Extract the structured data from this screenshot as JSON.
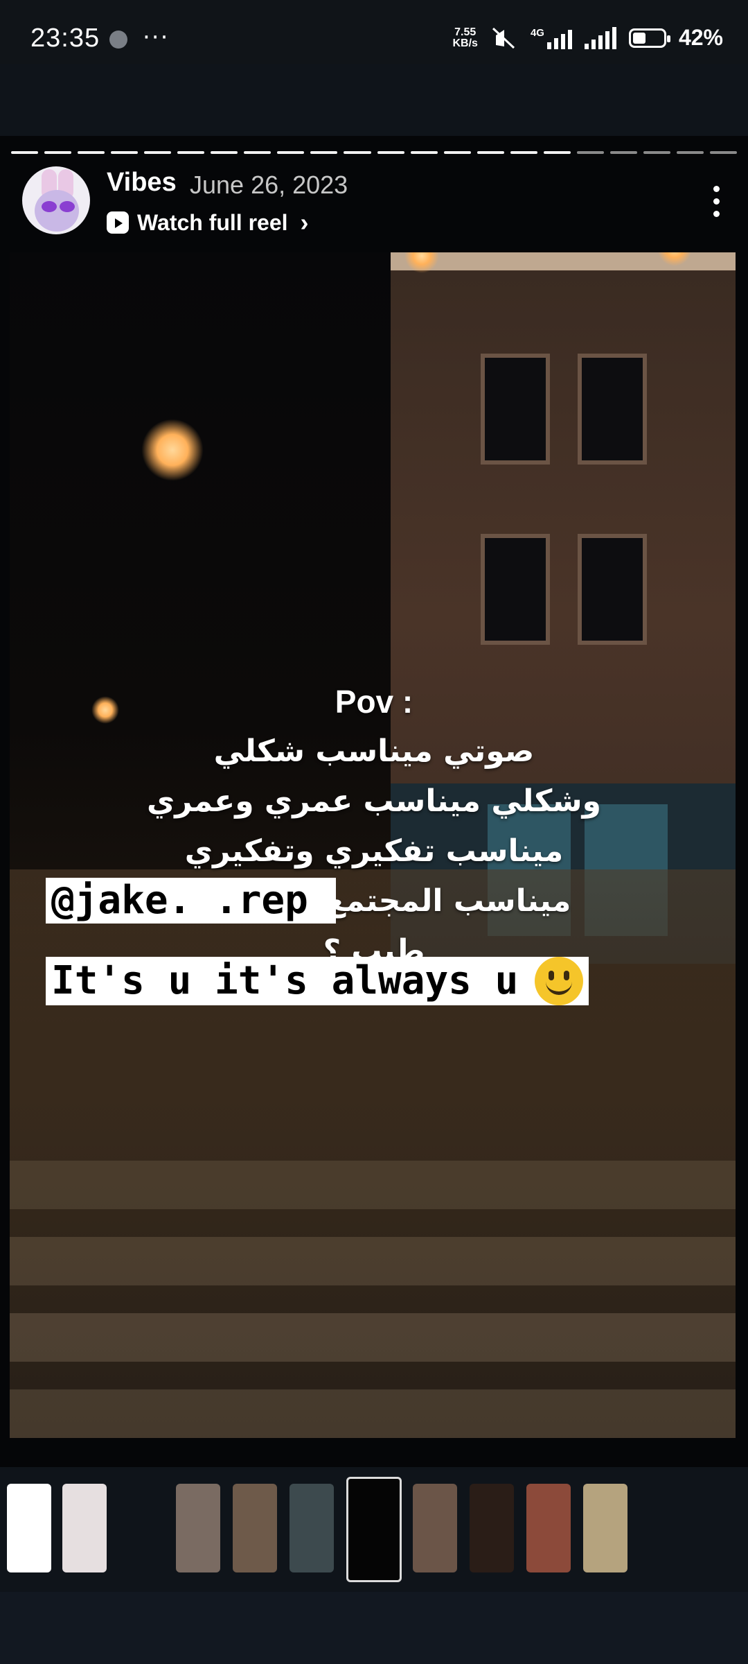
{
  "status_bar": {
    "time": "23:35",
    "more": "···",
    "speed_value": "7.55",
    "speed_unit": "KB/s",
    "network": "4G",
    "battery_percent": "42%"
  },
  "story": {
    "progress_segments_total": 22,
    "progress_segments_done": 17,
    "username": "Vibes",
    "date": "June 26, 2023",
    "reel_link": "Watch full reel",
    "caption_lines": [
      "Pov :",
      "صوتي ميناسب شكلي",
      "وشكلي ميناسب عمري وعمري",
      "ميناسب تفكيري وتفكيري",
      "ميناسب المجتمع وين اروح",
      "طيب ؟"
    ],
    "mention": "@jake.  .rep",
    "quote": "It's u it's always u"
  },
  "thumbnails": [
    {
      "name": "thumb-1",
      "color": "#ffffff"
    },
    {
      "name": "thumb-2",
      "color": "#e6dfe0"
    },
    {
      "name": "thumb-3",
      "color": "#0f141a"
    },
    {
      "name": "thumb-4",
      "color": "#7a6b62"
    },
    {
      "name": "thumb-5",
      "color": "#6e5a4a"
    },
    {
      "name": "thumb-6",
      "color": "#3d4a4e"
    },
    {
      "name": "thumb-7",
      "color": "#050505",
      "active": true
    },
    {
      "name": "thumb-8",
      "color": "#6b5548"
    },
    {
      "name": "thumb-9",
      "color": "#2a1d17"
    },
    {
      "name": "thumb-10",
      "color": "#8c4a3a"
    },
    {
      "name": "thumb-11",
      "color": "#b5a37e"
    }
  ]
}
